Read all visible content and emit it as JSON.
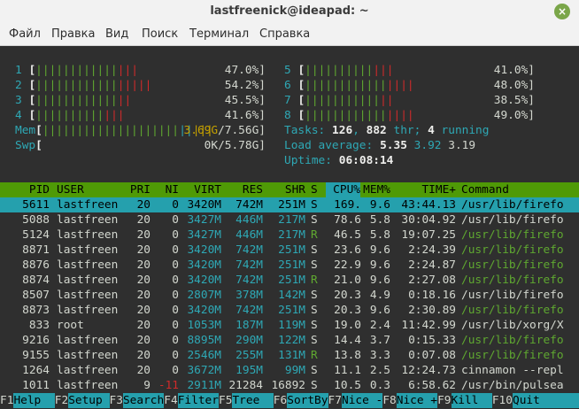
{
  "window": {
    "title": "lastfreenick@ideapad: ~",
    "close_glyph": "×"
  },
  "menu": [
    "Файл",
    "Правка",
    "Вид",
    "Поиск",
    "Терминал",
    "Справка"
  ],
  "cpus": [
    {
      "n": "1",
      "bar_g": "||||||||||||",
      "bar_r": "|||",
      "pct": "47.0%]"
    },
    {
      "n": "2",
      "bar_g": "||||||||||||",
      "bar_r": "|||||",
      "pct": "54.2%]"
    },
    {
      "n": "3",
      "bar_g": "||||||||||||",
      "bar_r": "||",
      "pct": "45.5%]"
    },
    {
      "n": "4",
      "bar_g": "||||||||||",
      "bar_r": "|||",
      "pct": "41.6%]"
    },
    {
      "n": "5",
      "bar_g": "||||||||||",
      "bar_r": "|||",
      "pct": "41.0%]"
    },
    {
      "n": "6",
      "bar_g": "||||||||||||",
      "bar_r": "||||",
      "pct": "48.0%]"
    },
    {
      "n": "7",
      "bar_g": "|||||||||||",
      "bar_r": "||",
      "pct": "38.5%]"
    },
    {
      "n": "8",
      "bar_g": "||||||||||||",
      "bar_r": "||||",
      "pct": "49.0%]"
    }
  ],
  "mem": {
    "label": "Mem",
    "bar_g": "||||||||||||||||||||",
    "bar_b": "||",
    "bar_y": "|||",
    "value": "3.69G/7.56G]"
  },
  "swp": {
    "label": "Swp",
    "value": "0K/5.78G]"
  },
  "tasks": {
    "label": "Tasks: ",
    "tasks": "126",
    "sep1": ", ",
    "thr": "882",
    "thr_label": " thr; ",
    "running": "4",
    "running_label": " running"
  },
  "load": {
    "label": "Load average: ",
    "l1": "5.35",
    "l5": "3.92",
    "l15": "3.19"
  },
  "uptime": {
    "label": "Uptime: ",
    "value": "06:08:14"
  },
  "columns": [
    "PID",
    "USER",
    "PRI",
    "NI",
    "VIRT",
    "RES",
    "SHR",
    "S",
    "CPU%",
    "MEM%",
    "TIME+",
    "Command"
  ],
  "processes": [
    {
      "pid": "5611",
      "user": "lastfreen",
      "pri": "20",
      "ni": "0",
      "virt": "3420M",
      "res": "742M",
      "shr": "251M",
      "s": "S",
      "cpu": "169.",
      "mem": "9.6",
      "time": "43:44.13",
      "cmd": "/usr/lib/firefo"
    },
    {
      "pid": "5088",
      "user": "lastfreen",
      "pri": "20",
      "ni": "0",
      "virt": "3427M",
      "res": "446M",
      "shr": "217M",
      "s": "S",
      "cpu": "78.6",
      "mem": "5.8",
      "time": "30:04.92",
      "cmd": "/usr/lib/firefo"
    },
    {
      "pid": "5124",
      "user": "lastfreen",
      "pri": "20",
      "ni": "0",
      "virt": "3427M",
      "res": "446M",
      "shr": "217M",
      "s": "R",
      "cpu": "46.5",
      "mem": "5.8",
      "time": "19:07.25",
      "cmd": "/usr/lib/firefo"
    },
    {
      "pid": "8871",
      "user": "lastfreen",
      "pri": "20",
      "ni": "0",
      "virt": "3420M",
      "res": "742M",
      "shr": "251M",
      "s": "S",
      "cpu": "23.6",
      "mem": "9.6",
      "time": "2:24.39",
      "cmd": "/usr/lib/firefo"
    },
    {
      "pid": "8876",
      "user": "lastfreen",
      "pri": "20",
      "ni": "0",
      "virt": "3420M",
      "res": "742M",
      "shr": "251M",
      "s": "S",
      "cpu": "22.9",
      "mem": "9.6",
      "time": "2:24.87",
      "cmd": "/usr/lib/firefo"
    },
    {
      "pid": "8874",
      "user": "lastfreen",
      "pri": "20",
      "ni": "0",
      "virt": "3420M",
      "res": "742M",
      "shr": "251M",
      "s": "R",
      "cpu": "21.0",
      "mem": "9.6",
      "time": "2:27.08",
      "cmd": "/usr/lib/firefo"
    },
    {
      "pid": "8507",
      "user": "lastfreen",
      "pri": "20",
      "ni": "0",
      "virt": "2807M",
      "res": "378M",
      "shr": "142M",
      "s": "S",
      "cpu": "20.3",
      "mem": "4.9",
      "time": "0:18.16",
      "cmd": "/usr/lib/firefo"
    },
    {
      "pid": "8873",
      "user": "lastfreen",
      "pri": "20",
      "ni": "0",
      "virt": "3420M",
      "res": "742M",
      "shr": "251M",
      "s": "S",
      "cpu": "20.3",
      "mem": "9.6",
      "time": "2:30.89",
      "cmd": "/usr/lib/firefo"
    },
    {
      "pid": "833",
      "user": "root",
      "pri": "20",
      "ni": "0",
      "virt": "1053M",
      "res": "187M",
      "shr": "119M",
      "s": "S",
      "cpu": "19.0",
      "mem": "2.4",
      "time": "11:42.99",
      "cmd": "/usr/lib/xorg/X"
    },
    {
      "pid": "9216",
      "user": "lastfreen",
      "pri": "20",
      "ni": "0",
      "virt": "8895M",
      "res": "290M",
      "shr": "122M",
      "s": "S",
      "cpu": "14.4",
      "mem": "3.7",
      "time": "0:15.33",
      "cmd": "/usr/lib/firefo"
    },
    {
      "pid": "9155",
      "user": "lastfreen",
      "pri": "20",
      "ni": "0",
      "virt": "2546M",
      "res": "255M",
      "shr": "131M",
      "s": "R",
      "cpu": "13.8",
      "mem": "3.3",
      "time": "0:07.08",
      "cmd": "/usr/lib/firefo"
    },
    {
      "pid": "1264",
      "user": "lastfreen",
      "pri": "20",
      "ni": "0",
      "virt": "3672M",
      "res": "195M",
      "shr": "99M",
      "s": "S",
      "cpu": "11.1",
      "mem": "2.5",
      "time": "12:24.73",
      "cmd": "cinnamon --repl"
    },
    {
      "pid": "1011",
      "user": "lastfreen",
      "pri": "9",
      "ni": "-11",
      "virt": "2911M",
      "res": "21284",
      "shr": "16892",
      "s": "S",
      "cpu": "10.5",
      "mem": "0.3",
      "time": "6:58.62",
      "cmd": "/usr/bin/pulsea"
    }
  ],
  "fkeys": [
    {
      "key": "F1",
      "label": "Help  "
    },
    {
      "key": "F2",
      "label": "Setup "
    },
    {
      "key": "F3",
      "label": "Search"
    },
    {
      "key": "F4",
      "label": "Filter"
    },
    {
      "key": "F5",
      "label": "Tree  "
    },
    {
      "key": "F6",
      "label": "SortBy"
    },
    {
      "key": "F7",
      "label": "Nice -"
    },
    {
      "key": "F8",
      "label": "Nice +"
    },
    {
      "key": "F9",
      "label": "Kill  "
    },
    {
      "key": "F10",
      "label": "Quit"
    }
  ]
}
